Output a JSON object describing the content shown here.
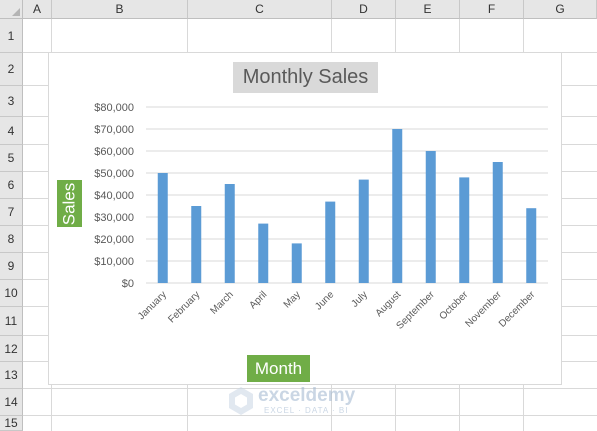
{
  "columns": [
    "A",
    "B",
    "C",
    "D",
    "E",
    "F",
    "G"
  ],
  "rows": [
    "1",
    "2",
    "3",
    "4",
    "5",
    "6",
    "7",
    "8",
    "9",
    "10",
    "11",
    "12",
    "13",
    "14",
    "15"
  ],
  "colors": {
    "bar": "#5b9bd5",
    "axis_title_bg": "#70ad47",
    "title_bg": "#d9d9d9"
  },
  "watermark": {
    "name": "exceldemy",
    "tagline": "EXCEL · DATA · BI"
  },
  "chart_data": {
    "type": "bar",
    "title": "Monthly Sales",
    "xlabel": "Month",
    "ylabel": "Sales",
    "categories": [
      "January",
      "February",
      "March",
      "April",
      "May",
      "June",
      "July",
      "August",
      "September",
      "October",
      "November",
      "December"
    ],
    "values": [
      50000,
      35000,
      45000,
      27000,
      18000,
      37000,
      47000,
      70000,
      60000,
      48000,
      55000,
      34000
    ],
    "ylim": [
      0,
      80000
    ],
    "yticks": [
      "$0",
      "$10,000",
      "$20,000",
      "$30,000",
      "$40,000",
      "$50,000",
      "$60,000",
      "$70,000",
      "$80,000"
    ],
    "grid": true,
    "legend": "none"
  }
}
